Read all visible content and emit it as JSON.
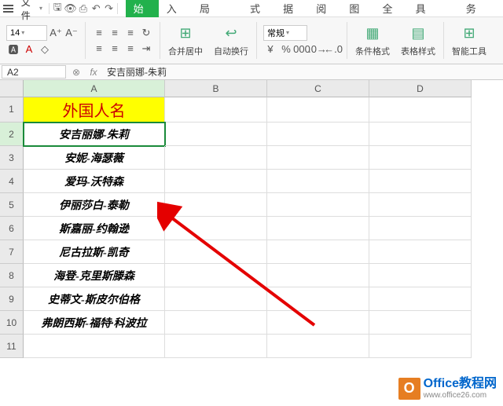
{
  "menu": {
    "file": "文件"
  },
  "tabs": [
    "开始",
    "插入",
    "页面布局",
    "公式",
    "数据",
    "审阅",
    "视图",
    "安全",
    "开发工具",
    "云服务"
  ],
  "activeTab": 0,
  "font": {
    "size": "14"
  },
  "numberFormat": "常规",
  "ribbonBtns": {
    "mergeCenter": "合并居中",
    "wrapText": "自动换行",
    "condFmt": "条件格式",
    "tableStyle": "表格样式",
    "smartTools": "智能工具"
  },
  "nameBox": "A2",
  "formulaBar": "安吉丽娜-朱莉",
  "columns": [
    "A",
    "B",
    "C",
    "D"
  ],
  "headerCell": "外国人名",
  "rows": [
    "安吉丽娜-朱莉",
    "安妮-海瑟薇",
    "爱玛-沃特森",
    "伊丽莎白-泰勒",
    "斯嘉丽-约翰逊",
    "尼古拉斯-凯奇",
    "海登-克里斯滕森",
    "史蒂文-斯皮尔伯格",
    "弗朗西斯-福特·科波拉"
  ],
  "selectedRow": 2,
  "watermark": {
    "title": "Office教程网",
    "url": "www.office26.com"
  }
}
